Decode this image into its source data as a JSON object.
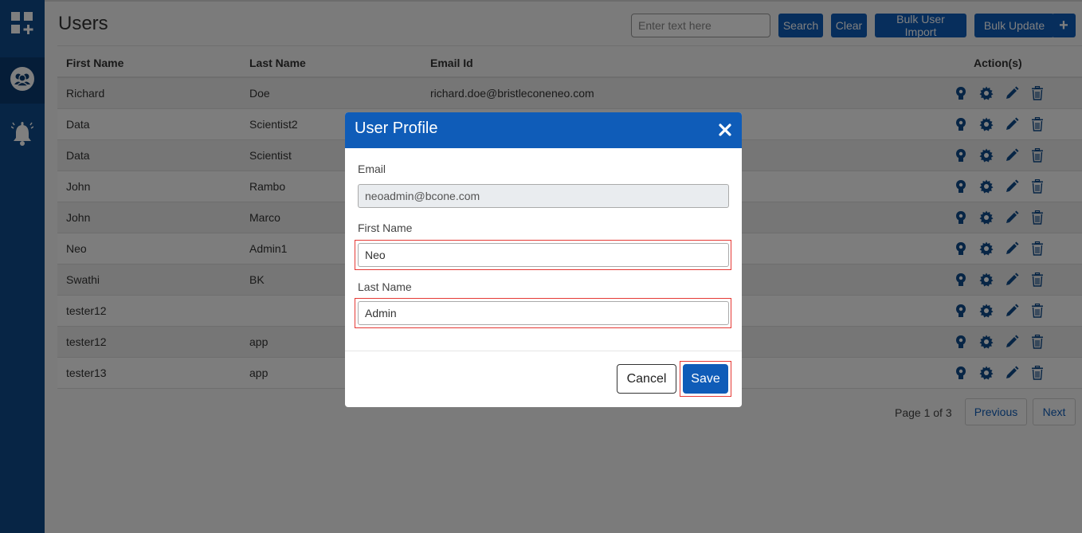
{
  "sidebar": {
    "items": [
      {
        "name": "apps-add-icon"
      },
      {
        "name": "users-group-icon",
        "active": true
      },
      {
        "name": "notification-bell-icon"
      }
    ]
  },
  "header": {
    "title": "Users",
    "search_placeholder": "Enter text here",
    "search_label": "Search",
    "clear_label": "Clear",
    "bulk_import_label": "Bulk User Import",
    "bulk_update_label": "Bulk Update",
    "add_label": "+"
  },
  "table": {
    "columns": [
      "First Name",
      "Last Name",
      "Email Id",
      "Action(s)"
    ],
    "rows": [
      {
        "first": "Richard",
        "last": "Doe",
        "email": "richard.doe@bristleconeneo.com"
      },
      {
        "first": "Data",
        "last": "Scientist2",
        "email": ""
      },
      {
        "first": "Data",
        "last": "Scientist",
        "email": ""
      },
      {
        "first": "John",
        "last": "Rambo",
        "email": ""
      },
      {
        "first": "John",
        "last": "Marco",
        "email": ""
      },
      {
        "first": "Neo",
        "last": "Admin1",
        "email": ""
      },
      {
        "first": "Swathi",
        "last": "BK",
        "email": ""
      },
      {
        "first": "tester12",
        "last": "",
        "email": ""
      },
      {
        "first": "tester12",
        "last": "app",
        "email": ""
      },
      {
        "first": "tester13",
        "last": "app",
        "email": ""
      }
    ],
    "action_icons": [
      "user-key-icon",
      "settings-gear-icon",
      "edit-pencil-icon",
      "delete-trash-icon"
    ]
  },
  "pagination": {
    "info": "Page 1 of 3",
    "previous_label": "Previous",
    "next_label": "Next"
  },
  "modal": {
    "title": "User Profile",
    "email_label": "Email",
    "email_value": "neoadmin@bcone.com",
    "first_name_label": "First Name",
    "first_name_value": "Neo",
    "last_name_label": "Last Name",
    "last_name_value": "Admin",
    "cancel_label": "Cancel",
    "save_label": "Save"
  },
  "colors": {
    "sidebar": "#0f4a8a",
    "primary": "#0f5cb8",
    "highlight": "#e53935"
  }
}
